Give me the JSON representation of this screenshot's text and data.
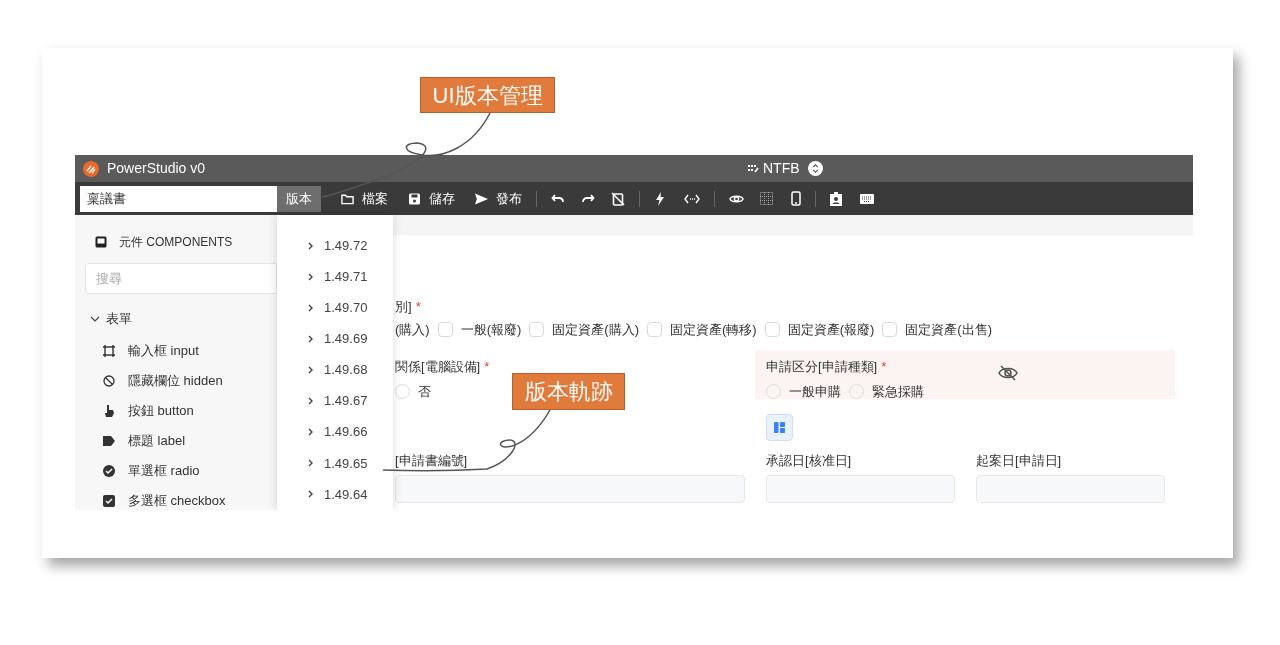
{
  "callouts": [
    {
      "text": "UI版本管理"
    },
    {
      "text": "版本軌跡"
    }
  ],
  "app": {
    "title": "PowerStudio v0",
    "project": "NTFB"
  },
  "toolbar": {
    "document_name": "稟議書",
    "version_button": "版本",
    "actions": [
      "檔案",
      "儲存",
      "發布"
    ]
  },
  "sidebar": {
    "title": "元件 COMPONENTS",
    "search": {
      "placeholder": "搜尋"
    },
    "group": {
      "label": "表單",
      "expanded": true,
      "items": [
        "輸入框 input",
        "隱藏欄位 hidden",
        "按鈕 button",
        "標題 label",
        "單選框 radio",
        "多選框 checkbox"
      ]
    }
  },
  "version_menu": [
    "1.49.72",
    "1.49.71",
    "1.49.70",
    "1.49.69",
    "1.49.68",
    "1.49.67",
    "1.49.66",
    "1.49.65",
    "1.49.64"
  ],
  "form": {
    "category": {
      "label": "別]",
      "mark": "*",
      "leading_text": "(購入)",
      "options": [
        {
          "label": "一般(報廢)",
          "checked": false
        },
        {
          "label": "固定資產(購入)",
          "checked": false
        },
        {
          "label": "固定資產(轉移)",
          "checked": false
        },
        {
          "label": "固定資產(報廢)",
          "checked": false
        },
        {
          "label": "固定資產(出售)",
          "checked": false
        }
      ]
    },
    "computer": {
      "label": "関係[電腦設備]",
      "mark": "*",
      "options": [
        {
          "label": "否",
          "selected": false
        }
      ]
    },
    "request_type": {
      "label": "申請区分[申請種類]",
      "mark": "*",
      "hidden": true,
      "options": [
        {
          "label": "一般申購",
          "selected": false
        },
        {
          "label": "緊急採購",
          "selected": false
        }
      ]
    },
    "fields": [
      {
        "label": "[申請書編號]"
      },
      {
        "label": "承認日[核准日]"
      },
      {
        "label": "起案日[申請日]"
      }
    ]
  }
}
